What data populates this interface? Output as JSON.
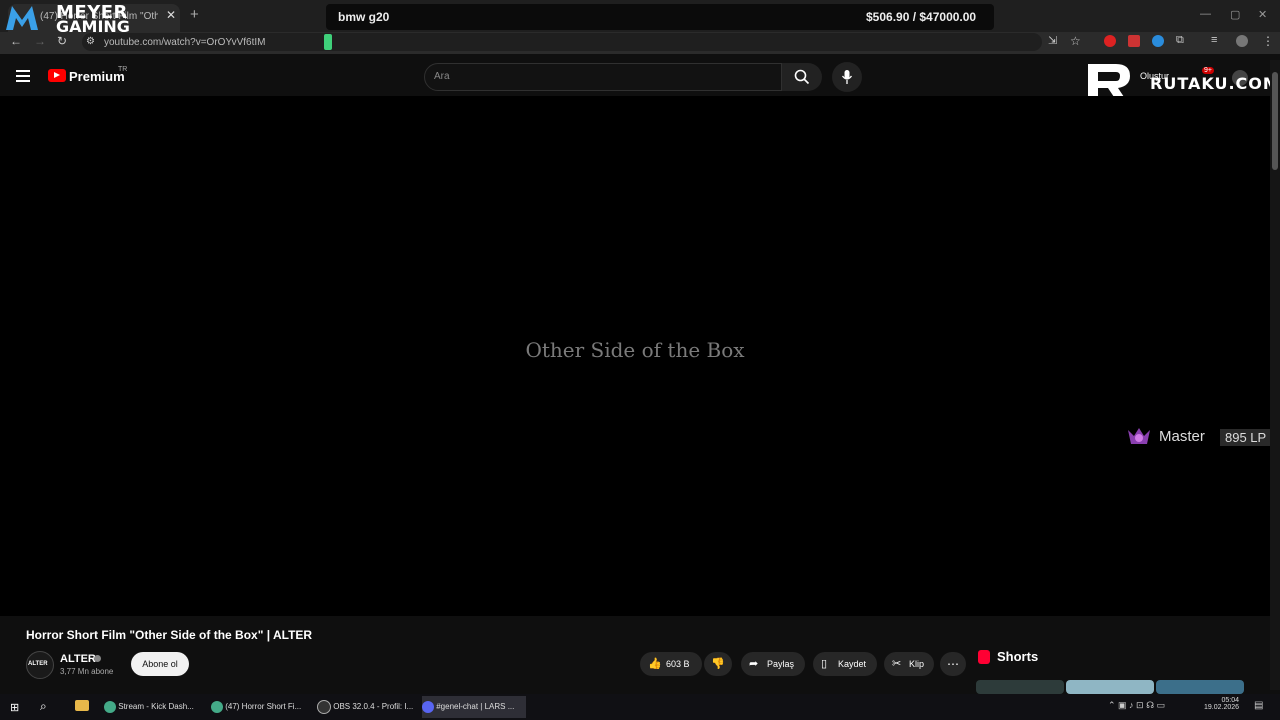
{
  "browser": {
    "tab_title": "(47) Horror Short Film \"Other Si",
    "new_tab_icon": "plus-icon",
    "url": "youtube.com/watch?v=OrOYvVf6tIM"
  },
  "overlay": {
    "sponsor_logo_top": "MEYER",
    "sponsor_logo_bottom": "GAMING",
    "ticker_left": "bmw g20",
    "ticker_right": "$506.90 / $47000.00",
    "site_logo_text": "RUTAKU.COM",
    "rank_name": "Master",
    "rank_lp": "895 LP"
  },
  "youtube": {
    "brand": "Premium",
    "region": "TR",
    "search_placeholder": "Ara",
    "create_label": "Oluştur",
    "notification_count": "9+",
    "video_overlay_text": "Other Side of the Box",
    "video_title": "Horror Short Film \"Other Side of the Box\" | ALTER",
    "channel": {
      "avatar_text": "ALTER",
      "name": "ALTER",
      "subscribers": "3,77 Mn abone",
      "subscribe_label": "Abone ol"
    },
    "actions": {
      "likes": "603 B",
      "share": "Paylaş",
      "save": "Kaydet",
      "clip": "Klip"
    },
    "shorts_label": "Shorts"
  },
  "taskbar": {
    "items": [
      "Stream - Kick Dash...",
      "(47) Horror Short Fi...",
      "OBS 32.0.4 - Profil: I...",
      "#genel-chat | LARS ..."
    ],
    "time": "05:04",
    "date": "19.02.2026"
  },
  "colors": {
    "accent_red": "#ff0000",
    "background": "#0f0f0f"
  }
}
